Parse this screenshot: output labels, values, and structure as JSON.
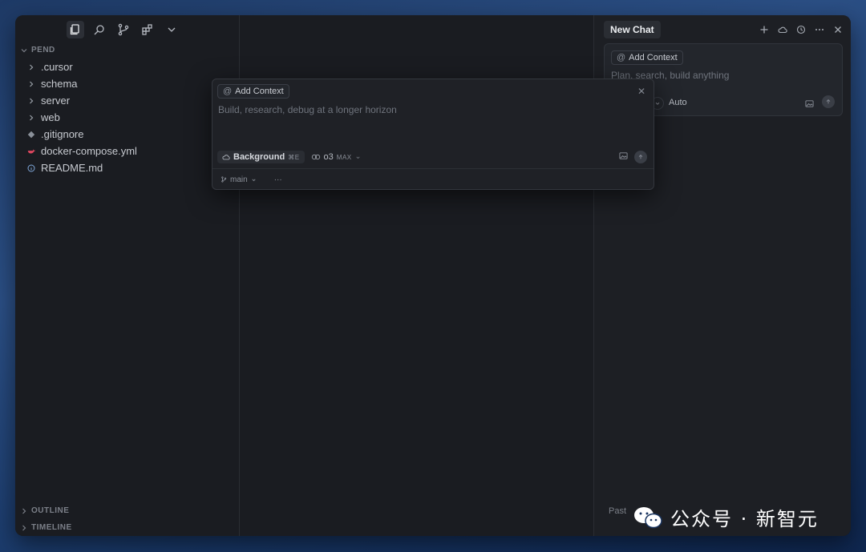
{
  "sidebar": {
    "toolbar_icons": [
      "files-icon",
      "search-icon",
      "source-control-icon",
      "extensions-icon",
      "chevron-down-icon"
    ],
    "project_name": "PEND",
    "tree": [
      {
        "label": ".cursor",
        "icon": "chevron-right-icon"
      },
      {
        "label": "schema",
        "icon": "chevron-right-icon"
      },
      {
        "label": "server",
        "icon": "chevron-right-icon"
      },
      {
        "label": "web",
        "icon": "chevron-right-icon"
      },
      {
        "label": ".gitignore",
        "icon": "git-icon"
      },
      {
        "label": "docker-compose.yml",
        "icon": "docker-icon"
      },
      {
        "label": "README.md",
        "icon": "info-icon"
      }
    ],
    "outline_label": "OUTLINE",
    "timeline_label": "TIMELINE"
  },
  "chat": {
    "title": "New Chat",
    "icons": [
      "plus-icon",
      "cloud-icon",
      "history-icon",
      "more-icon",
      "close-icon"
    ],
    "add_context": "Add Context",
    "placeholder": "Plan, search, build anything",
    "mode": "Auto",
    "past_label": "Past"
  },
  "popup": {
    "add_context": "Add Context",
    "placeholder": "Build, research, debug at a longer horizon",
    "background_label": "Background",
    "background_shortcut": "⌘E",
    "model": "o3",
    "model_badge": "MAX",
    "branch": "main",
    "more": "···"
  },
  "watermark": {
    "text": "公众号 · 新智元"
  },
  "colors": {
    "window_bg": "#1a1c21",
    "panel_bg": "#1d1f24",
    "accent_docker": "#e0475f"
  }
}
